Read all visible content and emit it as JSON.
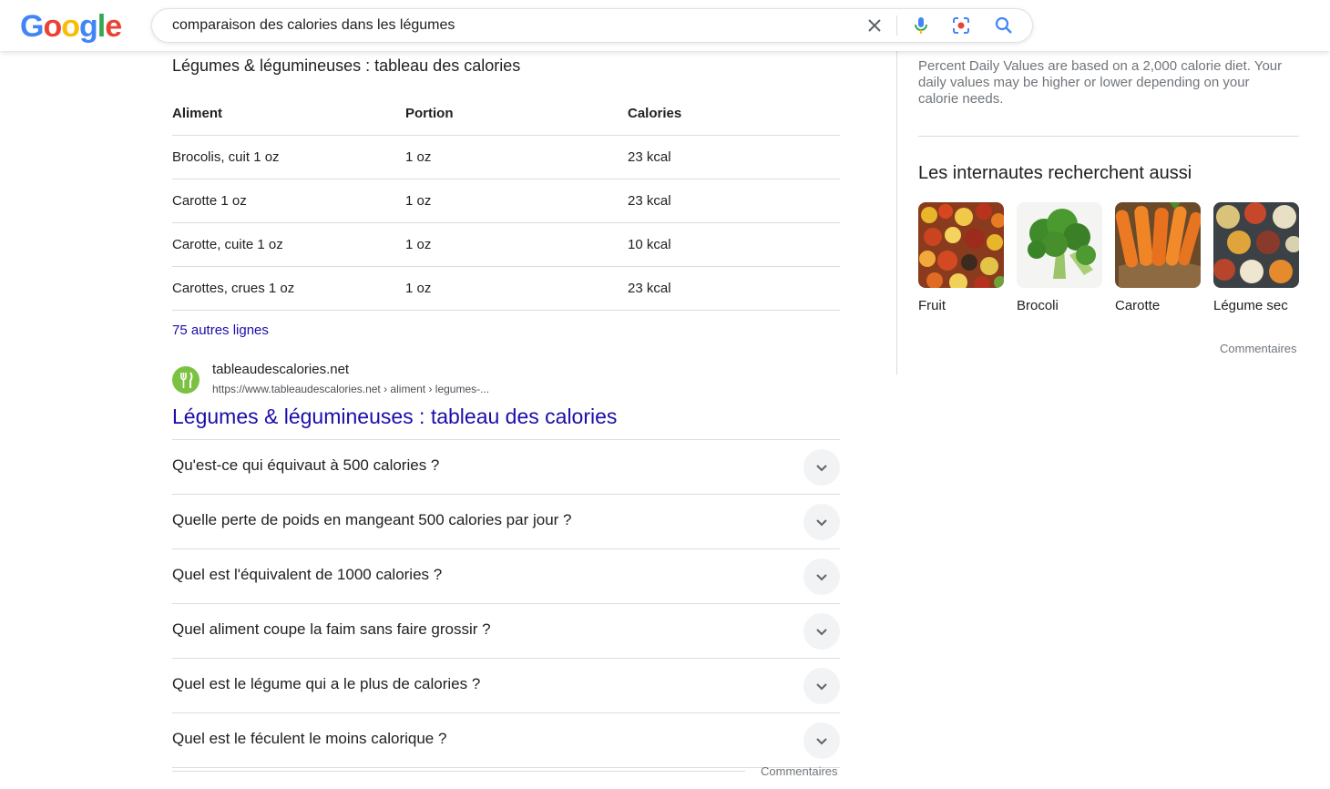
{
  "header": {
    "logo_letters": [
      "G",
      "o",
      "o",
      "g",
      "l",
      "e"
    ],
    "logo_colors": [
      "#4285F4",
      "#EA4335",
      "#FBBC05",
      "#4285F4",
      "#34A853",
      "#EA4335"
    ],
    "search_query": "comparaison des calories dans les légumes"
  },
  "table": {
    "title": "Légumes & légumineuses : tableau des calories",
    "headers": [
      "Aliment",
      "Portion",
      "Calories"
    ],
    "rows": [
      [
        "Brocolis, cuit 1 oz",
        "1 oz",
        "23 kcal"
      ],
      [
        "Carotte 1 oz",
        "1 oz",
        "23 kcal"
      ],
      [
        "Carotte, cuite 1 oz",
        "1 oz",
        "10 kcal"
      ],
      [
        "Carottes, crues 1 oz",
        "1 oz",
        "23 kcal"
      ]
    ],
    "more_rows": "75 autres lignes"
  },
  "result": {
    "site_name": "tableaudescalories.net",
    "url": "https://www.tableaudescalories.net › aliment › legumes-...",
    "title": "Légumes & légumineuses : tableau des calories"
  },
  "paa": {
    "questions": [
      "Qu'est-ce qui équivaut à 500 calories ?",
      "Quelle perte de poids en mangeant 500 calories par jour ?",
      "Quel est l'équivalent de 1000 calories ?",
      "Quel aliment coupe la faim sans faire grossir ?",
      "Quel est le légume qui a le plus de calories ?",
      "Quel est le féculent le moins calorique ?"
    ],
    "feedback": "Commentaires"
  },
  "right_panel": {
    "note": "Percent Daily Values are based on a 2,000 calorie diet. Your daily values may be higher or lower depending on your calorie needs.",
    "also_search_title": "Les internautes recherchent aussi",
    "items": [
      "Fruit",
      "Brocoli",
      "Carotte",
      "Légume sec"
    ],
    "feedback": "Commentaires"
  },
  "colors": {
    "link": "#1a0dab",
    "accent_green": "#7cc242"
  }
}
